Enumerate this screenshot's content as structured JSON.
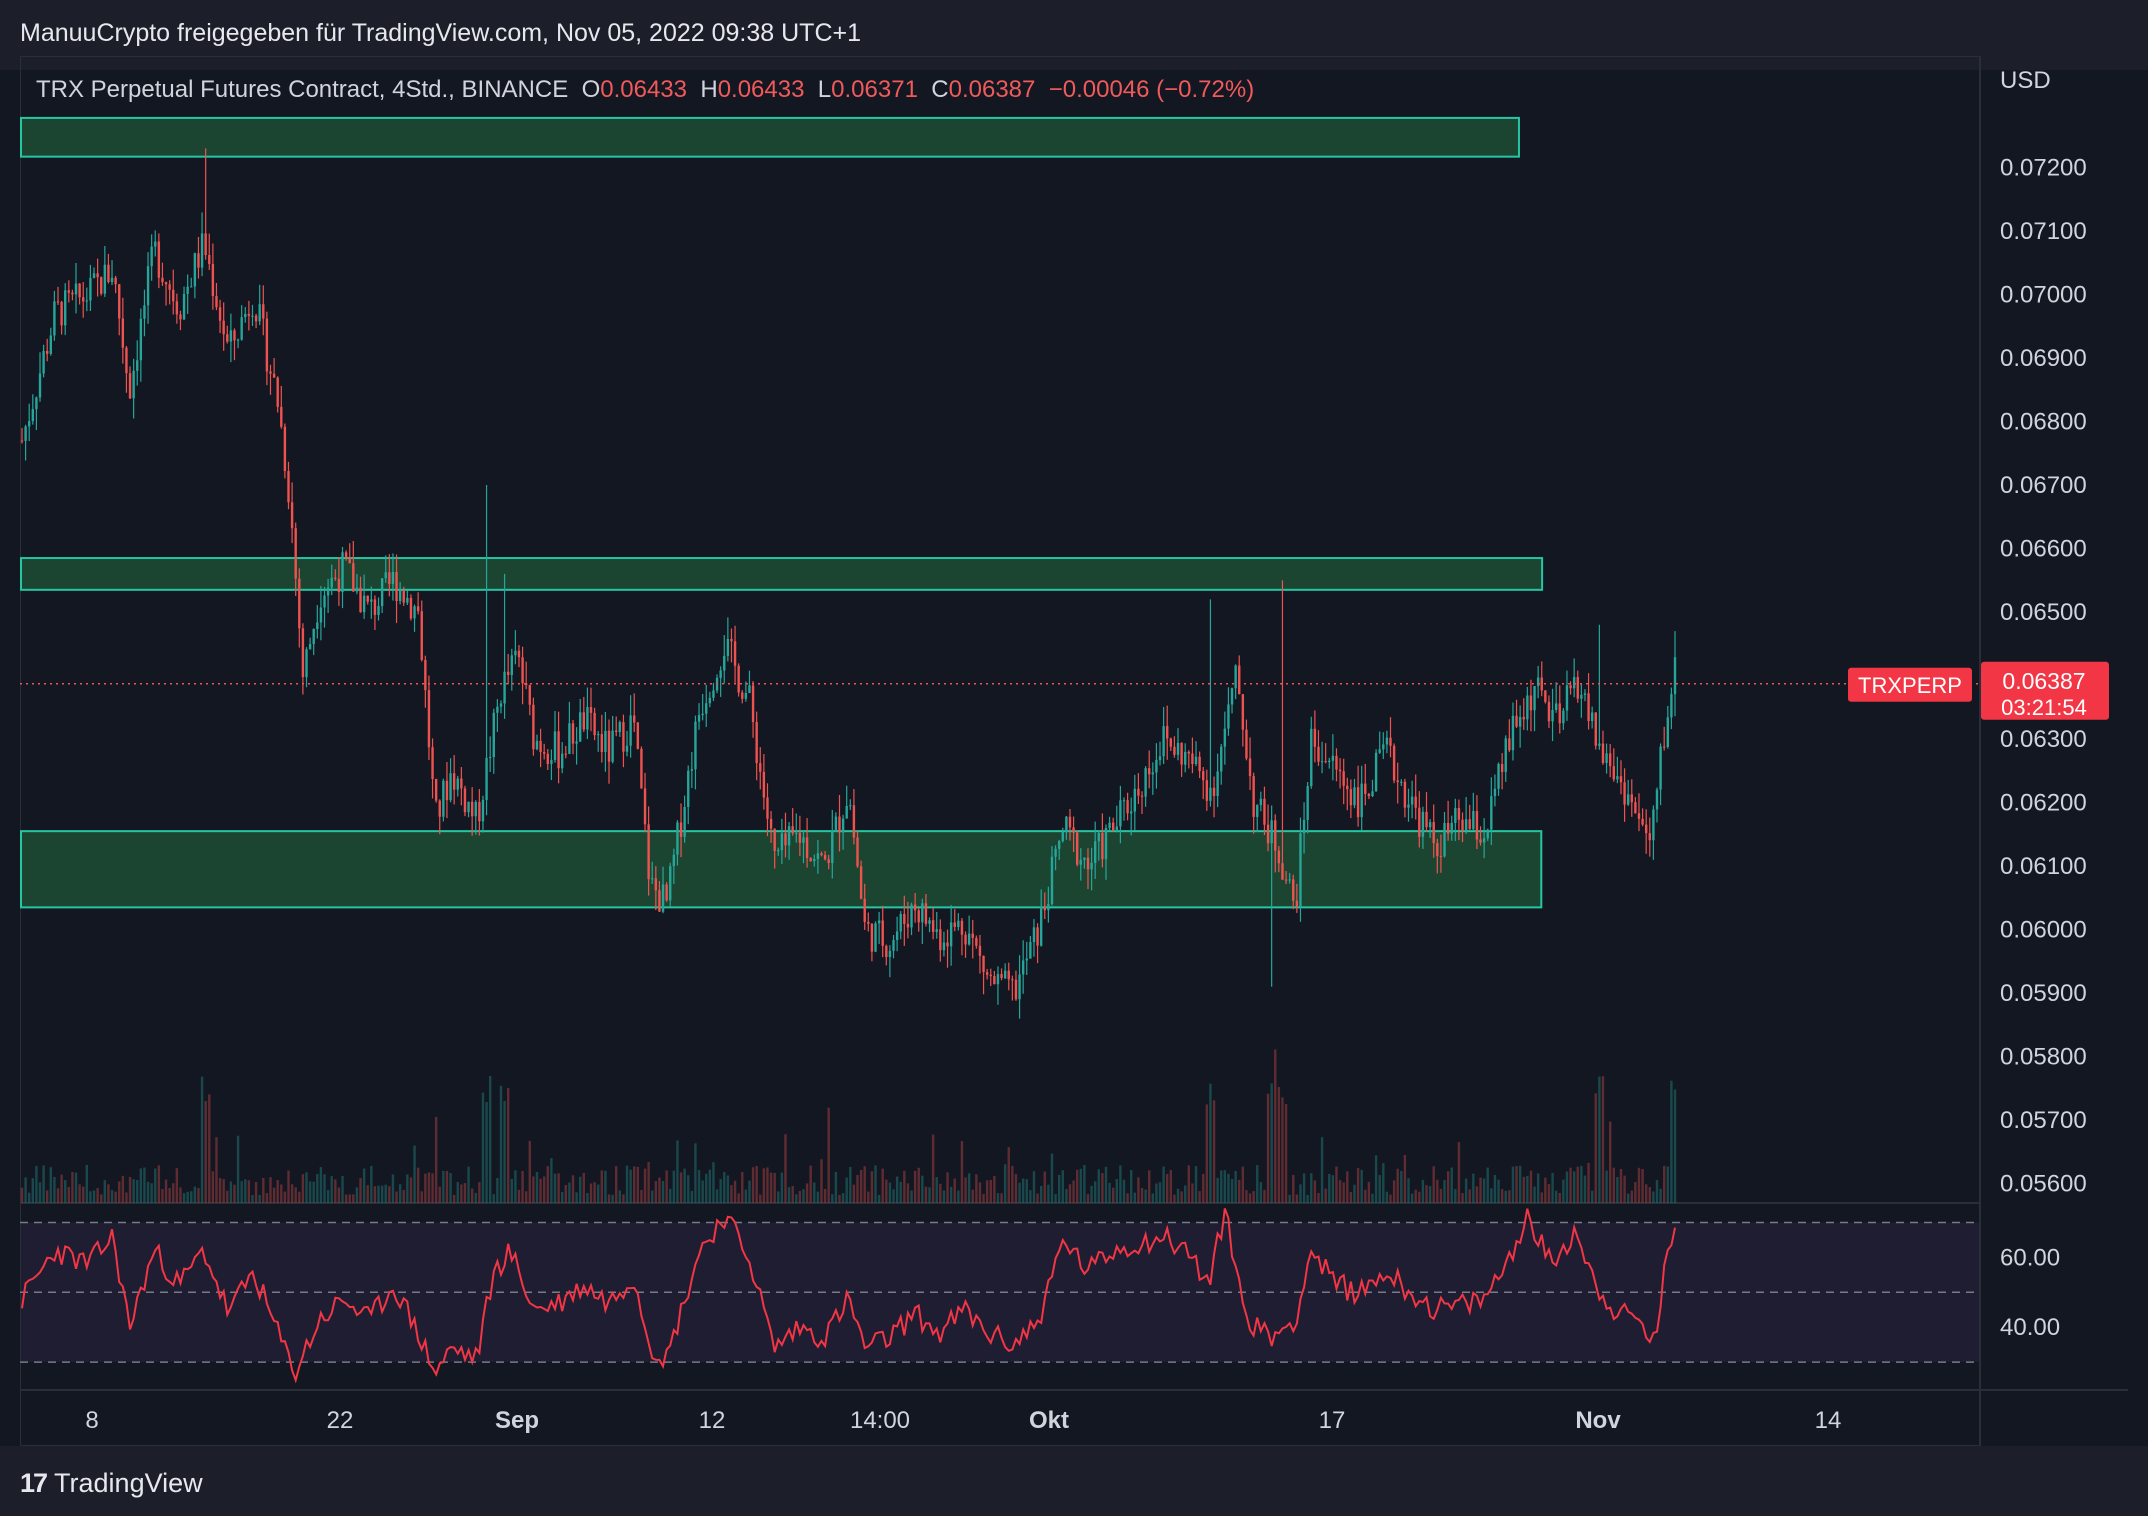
{
  "header": {
    "title": "ManuuCrypto freigegeben für TradingView.com, Nov 05, 2022 09:38 UTC+1"
  },
  "legend": {
    "symbol": "TRX Perpetual Futures Contract, 4Std., BINANCE",
    "o_label": "O",
    "o_value": "0.06433",
    "h_label": "H",
    "h_value": "0.06433",
    "l_label": "L",
    "l_value": "0.06371",
    "c_label": "C",
    "c_value": "0.06387",
    "change": "−0.00046 (−0.72%)"
  },
  "price_tag": {
    "symbol": "TRXPERP",
    "price": "0.06387",
    "countdown": "03:21:54"
  },
  "footer": {
    "logo_text": "TradingView"
  },
  "colors": {
    "background": "#131722",
    "up": "#26a69a",
    "down": "#ef5350",
    "rsi_line": "#f23645",
    "zone_fill": "#1e4d34",
    "zone_border": "#26c6a2",
    "price_tag": "#f23645"
  },
  "chart_data": {
    "type": "candlestick",
    "currency": "USD",
    "price_axis": {
      "ylim": [
        0.0559,
        0.0727
      ],
      "ticks": [
        "0.07200",
        "0.07100",
        "0.07000",
        "0.06900",
        "0.06800",
        "0.06700",
        "0.06600",
        "0.06500",
        "0.06300",
        "0.06200",
        "0.06100",
        "0.06000",
        "0.05900",
        "0.05800",
        "0.05700",
        "0.05600"
      ]
    },
    "time_axis": {
      "labels": [
        {
          "label": "8",
          "bold": false
        },
        {
          "label": "22",
          "bold": false
        },
        {
          "label": "Sep",
          "bold": true
        },
        {
          "label": "12",
          "bold": false
        },
        {
          "label": "14:00",
          "bold": false
        },
        {
          "label": "Okt",
          "bold": true
        },
        {
          "label": "17",
          "bold": false
        },
        {
          "label": "Nov",
          "bold": true
        },
        {
          "label": "14",
          "bold": false
        }
      ]
    },
    "price_path": [
      {
        "t": 0.0,
        "p": 0.0677
      },
      {
        "t": 0.02,
        "p": 0.0697
      },
      {
        "t": 0.04,
        "p": 0.07
      },
      {
        "t": 0.055,
        "p": 0.0704
      },
      {
        "t": 0.065,
        "p": 0.0685
      },
      {
        "t": 0.08,
        "p": 0.0707
      },
      {
        "t": 0.095,
        "p": 0.0698
      },
      {
        "t": 0.11,
        "p": 0.0708
      },
      {
        "t": 0.125,
        "p": 0.0691
      },
      {
        "t": 0.14,
        "p": 0.07
      },
      {
        "t": 0.155,
        "p": 0.0683
      },
      {
        "t": 0.162,
        "p": 0.0668
      },
      {
        "t": 0.17,
        "p": 0.064
      },
      {
        "t": 0.18,
        "p": 0.0653
      },
      {
        "t": 0.195,
        "p": 0.0657
      },
      {
        "t": 0.21,
        "p": 0.065
      },
      {
        "t": 0.225,
        "p": 0.0655
      },
      {
        "t": 0.24,
        "p": 0.065
      },
      {
        "t": 0.25,
        "p": 0.0617
      },
      {
        "t": 0.26,
        "p": 0.0625
      },
      {
        "t": 0.275,
        "p": 0.0617
      },
      {
        "t": 0.29,
        "p": 0.0638
      },
      {
        "t": 0.3,
        "p": 0.0643
      },
      {
        "t": 0.31,
        "p": 0.063
      },
      {
        "t": 0.325,
        "p": 0.0628
      },
      {
        "t": 0.34,
        "p": 0.0633
      },
      {
        "t": 0.355,
        "p": 0.0628
      },
      {
        "t": 0.37,
        "p": 0.0633
      },
      {
        "t": 0.38,
        "p": 0.0607
      },
      {
        "t": 0.39,
        "p": 0.0604
      },
      {
        "t": 0.41,
        "p": 0.0635
      },
      {
        "t": 0.425,
        "p": 0.0645
      },
      {
        "t": 0.44,
        "p": 0.0636
      },
      {
        "t": 0.455,
        "p": 0.0611
      },
      {
        "t": 0.47,
        "p": 0.0615
      },
      {
        "t": 0.485,
        "p": 0.061
      },
      {
        "t": 0.5,
        "p": 0.0622
      },
      {
        "t": 0.51,
        "p": 0.06
      },
      {
        "t": 0.525,
        "p": 0.0598
      },
      {
        "t": 0.54,
        "p": 0.0604
      },
      {
        "t": 0.555,
        "p": 0.0599
      },
      {
        "t": 0.57,
        "p": 0.0601
      },
      {
        "t": 0.585,
        "p": 0.0592
      },
      {
        "t": 0.6,
        "p": 0.059
      },
      {
        "t": 0.615,
        "p": 0.06
      },
      {
        "t": 0.63,
        "p": 0.0616
      },
      {
        "t": 0.645,
        "p": 0.061
      },
      {
        "t": 0.66,
        "p": 0.0616
      },
      {
        "t": 0.675,
        "p": 0.0622
      },
      {
        "t": 0.69,
        "p": 0.063
      },
      {
        "t": 0.705,
        "p": 0.0627
      },
      {
        "t": 0.72,
        "p": 0.0622
      },
      {
        "t": 0.735,
        "p": 0.064
      },
      {
        "t": 0.745,
        "p": 0.062
      },
      {
        "t": 0.76,
        "p": 0.0613
      },
      {
        "t": 0.77,
        "p": 0.0603
      },
      {
        "t": 0.78,
        "p": 0.063
      },
      {
        "t": 0.795,
        "p": 0.0625
      },
      {
        "t": 0.81,
        "p": 0.062
      },
      {
        "t": 0.825,
        "p": 0.0628
      },
      {
        "t": 0.84,
        "p": 0.062
      },
      {
        "t": 0.855,
        "p": 0.0613
      },
      {
        "t": 0.87,
        "p": 0.0617
      },
      {
        "t": 0.885,
        "p": 0.0615
      },
      {
        "t": 0.9,
        "p": 0.063
      },
      {
        "t": 0.915,
        "p": 0.0638
      },
      {
        "t": 0.93,
        "p": 0.0632
      },
      {
        "t": 0.94,
        "p": 0.064
      },
      {
        "t": 0.955,
        "p": 0.0628
      },
      {
        "t": 0.97,
        "p": 0.0622
      },
      {
        "t": 0.985,
        "p": 0.0613
      },
      {
        "t": 0.993,
        "p": 0.063
      },
      {
        "t": 1.0,
        "p": 0.0641
      }
    ],
    "spikes": [
      {
        "t": 0.111,
        "p": 0.0723
      },
      {
        "t": 0.282,
        "p": 0.067
      },
      {
        "t": 0.292,
        "p": 0.0656
      },
      {
        "t": 0.718,
        "p": 0.0652
      },
      {
        "t": 0.762,
        "p": 0.0655
      },
      {
        "t": 0.755,
        "p": 0.0591
      },
      {
        "t": 0.954,
        "p": 0.0648
      },
      {
        "t": 0.999,
        "p": 0.0647
      }
    ],
    "zones": [
      {
        "name": "top-resistance",
        "low": 0.07217,
        "high": 0.07278,
        "x_end": 0.905
      },
      {
        "name": "mid-resistance",
        "low": 0.06535,
        "high": 0.06585,
        "x_end": 0.919
      },
      {
        "name": "support",
        "low": 0.06035,
        "high": 0.06155,
        "x_end": 0.9185
      }
    ],
    "current_price": 0.06387,
    "rsi": {
      "ticks": [
        "60.00",
        "40.00"
      ],
      "ylim": [
        22,
        75
      ],
      "levels": [
        70,
        50,
        30
      ],
      "path": [
        {
          "t": 0.0,
          "v": 48
        },
        {
          "t": 0.02,
          "v": 62
        },
        {
          "t": 0.04,
          "v": 58
        },
        {
          "t": 0.055,
          "v": 66
        },
        {
          "t": 0.065,
          "v": 40
        },
        {
          "t": 0.08,
          "v": 62
        },
        {
          "t": 0.095,
          "v": 52
        },
        {
          "t": 0.11,
          "v": 62
        },
        {
          "t": 0.125,
          "v": 44
        },
        {
          "t": 0.14,
          "v": 56
        },
        {
          "t": 0.155,
          "v": 38
        },
        {
          "t": 0.165,
          "v": 27
        },
        {
          "t": 0.18,
          "v": 42
        },
        {
          "t": 0.195,
          "v": 48
        },
        {
          "t": 0.21,
          "v": 42
        },
        {
          "t": 0.225,
          "v": 52
        },
        {
          "t": 0.24,
          "v": 38
        },
        {
          "t": 0.25,
          "v": 27
        },
        {
          "t": 0.26,
          "v": 34
        },
        {
          "t": 0.275,
          "v": 31
        },
        {
          "t": 0.285,
          "v": 55
        },
        {
          "t": 0.295,
          "v": 62
        },
        {
          "t": 0.31,
          "v": 45
        },
        {
          "t": 0.325,
          "v": 47
        },
        {
          "t": 0.34,
          "v": 52
        },
        {
          "t": 0.355,
          "v": 47
        },
        {
          "t": 0.37,
          "v": 55
        },
        {
          "t": 0.38,
          "v": 35
        },
        {
          "t": 0.39,
          "v": 31
        },
        {
          "t": 0.41,
          "v": 62
        },
        {
          "t": 0.425,
          "v": 72
        },
        {
          "t": 0.44,
          "v": 60
        },
        {
          "t": 0.455,
          "v": 34
        },
        {
          "t": 0.47,
          "v": 40
        },
        {
          "t": 0.485,
          "v": 37
        },
        {
          "t": 0.5,
          "v": 48
        },
        {
          "t": 0.51,
          "v": 34
        },
        {
          "t": 0.525,
          "v": 37
        },
        {
          "t": 0.54,
          "v": 44
        },
        {
          "t": 0.555,
          "v": 38
        },
        {
          "t": 0.57,
          "v": 45
        },
        {
          "t": 0.585,
          "v": 38
        },
        {
          "t": 0.6,
          "v": 35
        },
        {
          "t": 0.615,
          "v": 42
        },
        {
          "t": 0.63,
          "v": 65
        },
        {
          "t": 0.645,
          "v": 56
        },
        {
          "t": 0.66,
          "v": 62
        },
        {
          "t": 0.675,
          "v": 64
        },
        {
          "t": 0.69,
          "v": 66
        },
        {
          "t": 0.705,
          "v": 62
        },
        {
          "t": 0.718,
          "v": 52
        },
        {
          "t": 0.728,
          "v": 74
        },
        {
          "t": 0.74,
          "v": 43
        },
        {
          "t": 0.755,
          "v": 37
        },
        {
          "t": 0.77,
          "v": 42
        },
        {
          "t": 0.78,
          "v": 62
        },
        {
          "t": 0.795,
          "v": 52
        },
        {
          "t": 0.81,
          "v": 50
        },
        {
          "t": 0.825,
          "v": 56
        },
        {
          "t": 0.84,
          "v": 50
        },
        {
          "t": 0.855,
          "v": 45
        },
        {
          "t": 0.87,
          "v": 46
        },
        {
          "t": 0.885,
          "v": 48
        },
        {
          "t": 0.9,
          "v": 60
        },
        {
          "t": 0.91,
          "v": 72
        },
        {
          "t": 0.925,
          "v": 58
        },
        {
          "t": 0.94,
          "v": 68
        },
        {
          "t": 0.952,
          "v": 52
        },
        {
          "t": 0.965,
          "v": 44
        },
        {
          "t": 0.978,
          "v": 42
        },
        {
          "t": 0.988,
          "v": 35
        },
        {
          "t": 0.995,
          "v": 60
        },
        {
          "t": 1.0,
          "v": 70
        }
      ]
    }
  }
}
